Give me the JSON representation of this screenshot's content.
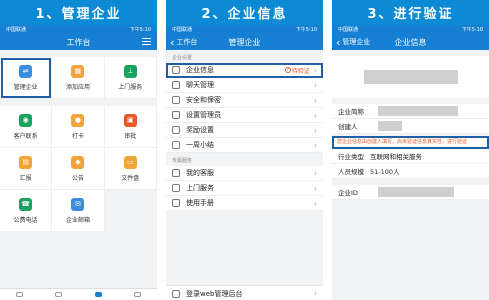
{
  "steps": {
    "step1": "1、管理企业",
    "step2": "2、企业信息",
    "step3": "3、进行验证"
  },
  "status": {
    "carrier": "中国联通",
    "time": "下午5:10"
  },
  "panel1": {
    "title": "工作台",
    "tiles": [
      {
        "label": "管理企业",
        "color": "#3c8de0",
        "glyph": "⇌"
      },
      {
        "label": "添加应用",
        "color": "#f2a33a",
        "glyph": "▦"
      },
      {
        "label": "上门服务",
        "color": "#1aa35e",
        "glyph": "⊥"
      },
      {
        "label": "客户联系",
        "color": "#1aa35e",
        "glyph": "◉"
      },
      {
        "label": "打卡",
        "color": "#f2a33a",
        "glyph": "●"
      },
      {
        "label": "审批",
        "color": "#e8592a",
        "glyph": "▣"
      },
      {
        "label": "汇报",
        "color": "#f2a33a",
        "glyph": "▤"
      },
      {
        "label": "公告",
        "color": "#f2a33a",
        "glyph": "◆"
      },
      {
        "label": "文件盘",
        "color": "#f2a33a",
        "glyph": "▭"
      },
      {
        "label": "公费电话",
        "color": "#1aa35e",
        "glyph": "☎"
      },
      {
        "label": "企业邮箱",
        "color": "#3c8de0",
        "glyph": "✉"
      }
    ]
  },
  "panel2": {
    "back": "工作台",
    "title": "管理企业",
    "section1": "企业设置",
    "items1": [
      {
        "label": "企业信息",
        "badge": "待验证"
      },
      {
        "label": "聊天管理"
      },
      {
        "label": "安全和保密"
      },
      {
        "label": "设置管理员"
      },
      {
        "label": "奖励设置"
      },
      {
        "label": "一周小结"
      }
    ],
    "section2": "专属服务",
    "items2": [
      {
        "label": "我的客服"
      },
      {
        "label": "上门服务"
      },
      {
        "label": "使用手册"
      }
    ],
    "footer": "登录web管理后台"
  },
  "panel3": {
    "back": "管理企业",
    "title": "企业信息",
    "fields_top": [
      {
        "key": "企业简称"
      },
      {
        "key": "创建人"
      }
    ],
    "warning": "您企业信息由创建人填写，尚未验证信息真实性，进行验证",
    "fields_bottom": [
      {
        "key": "行业类型",
        "value": "互联网和相关服务"
      },
      {
        "key": "人员规模",
        "value": "51-100人"
      }
    ],
    "id_key": "企业ID"
  }
}
